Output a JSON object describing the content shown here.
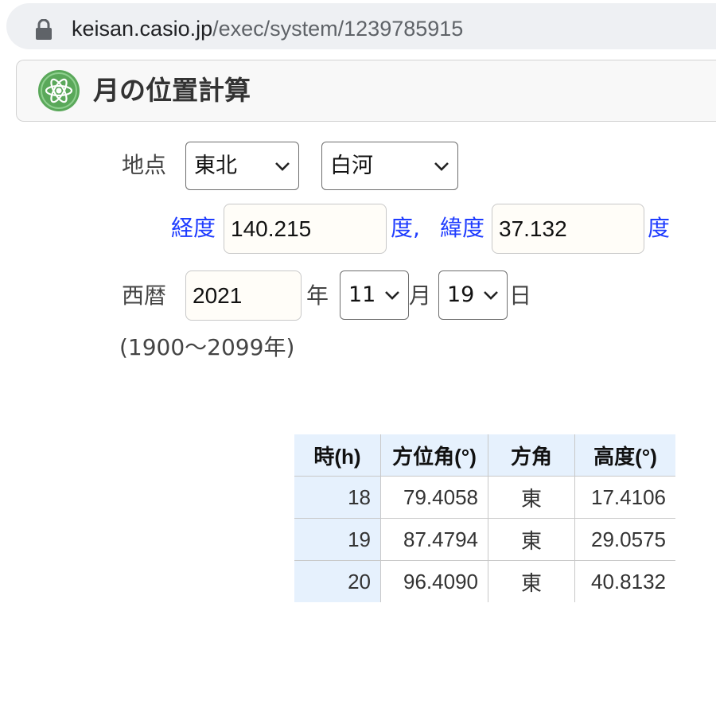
{
  "browser": {
    "url_host": "keisan.casio.jp",
    "url_path": "/exec/system/1239785915",
    "lock_icon": "lock-icon"
  },
  "header": {
    "title": "月の位置計算",
    "logo_icon": "atom-icon",
    "logo_color": "#5aa85a"
  },
  "form": {
    "location_label": "地点",
    "region": "東北",
    "city": "白河",
    "longitude_label": "経度",
    "longitude": "140.215",
    "longitude_unit": "度,",
    "latitude_label": "緯度",
    "latitude": "37.132",
    "latitude_unit": "度",
    "era_label": "西暦",
    "year": "2021",
    "year_unit": "年",
    "month": "11",
    "month_unit": "月",
    "day": "19",
    "day_unit": "日",
    "year_range_note": "(1900〜2099年)"
  },
  "table": {
    "headers": [
      "時(h)",
      "方位角(°)",
      "方角",
      "高度(°)"
    ],
    "rows": [
      {
        "hour": "18",
        "azimuth": "79.4058",
        "direction": "東",
        "altitude": "17.4106"
      },
      {
        "hour": "19",
        "azimuth": "87.4794",
        "direction": "東",
        "altitude": "29.0575"
      },
      {
        "hour": "20",
        "azimuth": "96.4090",
        "direction": "東",
        "altitude": "40.8132"
      }
    ]
  },
  "colors": {
    "label_blue": "#1f3cff",
    "table_header_bg": "#e6f1fd"
  }
}
